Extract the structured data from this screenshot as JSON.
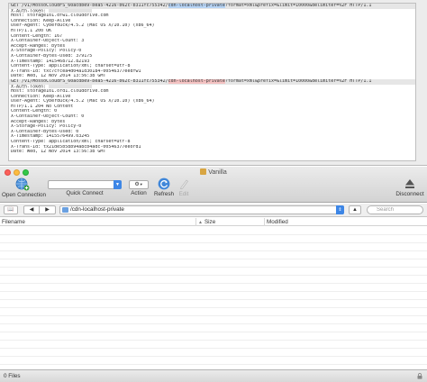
{
  "transcript": {
    "lines": [
      {
        "kind": "req",
        "parts": [
          {
            "t": "GET /v1/MossoCloudFS_60acdbe9-bea5-4216-b62c-b311fc755342/"
          },
          {
            "t": "cdn-localhost-private",
            "mark": "blue"
          },
          {
            "t": "?format=xml&prefix=&limit=10000&delimiter=%2F HTTP/1.1"
          }
        ]
      },
      {
        "kind": "hdr",
        "parts": [
          {
            "t": "X-Auth-Token: "
          },
          {
            "redact": true
          }
        ]
      },
      {
        "kind": "hdr",
        "parts": [
          {
            "t": "Host: storage101.dfw1.clouddrive.com"
          }
        ]
      },
      {
        "kind": "hdr",
        "parts": [
          {
            "t": "Connection: Keep-Alive"
          }
        ]
      },
      {
        "kind": "hdr",
        "parts": [
          {
            "t": "User-Agent: Cyberduck/4.5.2 (Mac OS X/10.10) (x86_64)"
          }
        ]
      },
      {
        "kind": "hdr",
        "parts": [
          {
            "t": "HTTP/1.1 200 OK"
          }
        ]
      },
      {
        "kind": "hdr",
        "parts": [
          {
            "t": "Content-Length: 167"
          }
        ]
      },
      {
        "kind": "hdr",
        "parts": [
          {
            "t": "X-Container-Object-Count: 3"
          }
        ]
      },
      {
        "kind": "hdr",
        "parts": [
          {
            "t": "Accept-Ranges: bytes"
          }
        ]
      },
      {
        "kind": "hdr",
        "parts": [
          {
            "t": "X-Storage-Policy: Policy-0"
          }
        ]
      },
      {
        "kind": "hdr",
        "parts": [
          {
            "t": "X-Container-Bytes-Used: 379175"
          }
        ]
      },
      {
        "kind": "hdr",
        "parts": [
          {
            "t": "X-Timestamp: 1415468712.82193"
          }
        ]
      },
      {
        "kind": "hdr",
        "parts": [
          {
            "t": "Content-Type: application/xml; charset=utf-8"
          }
        ]
      },
      {
        "kind": "hdr",
        "parts": [
          {
            "t": "X-Trans-Id: txc7cfcea4d04a1d30184-00546377eedfw1"
          }
        ]
      },
      {
        "kind": "hdr",
        "parts": [
          {
            "t": "Date: Wed, 12 Nov 2014 13:56:38 GMT"
          }
        ]
      },
      {
        "kind": "req",
        "parts": [
          {
            "t": "GET /v1/MossoCloudFS_60acdbe9-bea5-4216-b62c-b311fc755342/"
          },
          {
            "t": "cdn-localhost-private",
            "mark": "red"
          },
          {
            "t": "?format=xml&prefix=&limit=10000&delimiter=%2F HTTP/1.1"
          }
        ]
      },
      {
        "kind": "hdr",
        "parts": [
          {
            "t": "X-Auth-Token: "
          },
          {
            "redact": true
          }
        ]
      },
      {
        "kind": "hdr",
        "parts": [
          {
            "t": "Host: storage101.ord1.clouddrive.com"
          }
        ]
      },
      {
        "kind": "hdr",
        "parts": [
          {
            "t": "Connection: Keep-Alive"
          }
        ]
      },
      {
        "kind": "hdr",
        "parts": [
          {
            "t": "User-Agent: Cyberduck/4.5.2 (Mac OS X/10.10) (x86_64)"
          }
        ]
      },
      {
        "kind": "hdr",
        "parts": [
          {
            "t": "HTTP/1.1 204 No Content"
          }
        ]
      },
      {
        "kind": "hdr",
        "parts": [
          {
            "t": "Content-Length: 0"
          }
        ]
      },
      {
        "kind": "hdr",
        "parts": [
          {
            "t": "X-Container-Object-Count: 0"
          }
        ]
      },
      {
        "kind": "hdr",
        "parts": [
          {
            "t": "Accept-Ranges: bytes"
          }
        ]
      },
      {
        "kind": "hdr",
        "parts": [
          {
            "t": "X-Storage-Policy: Policy-0"
          }
        ]
      },
      {
        "kind": "hdr",
        "parts": [
          {
            "t": "X-Container-Bytes-Used: 0"
          }
        ]
      },
      {
        "kind": "hdr",
        "parts": [
          {
            "t": "X-Timestamp: 1415576499.03245"
          }
        ]
      },
      {
        "kind": "hdr",
        "parts": [
          {
            "t": "Content-Type: application/xml; charset=utf-8"
          }
        ]
      },
      {
        "kind": "hdr",
        "parts": [
          {
            "t": "X-Trans-Id: tx21de5b58b94a8cb4adc-00546377eeord1"
          }
        ]
      },
      {
        "kind": "hdr",
        "parts": [
          {
            "t": "Date: Wed, 12 Nov 2014 13:56:38 GMT"
          }
        ]
      }
    ]
  },
  "window": {
    "title": "Vanilla"
  },
  "toolbar": {
    "open_connection": "Open Connection",
    "quick_connect": "Quick Connect",
    "action": "Action",
    "refresh": "Refresh",
    "edit": "Edit",
    "disconnect": "Disconnect"
  },
  "pathbar": {
    "path": "/cdn-localhost-private",
    "search_placeholder": "Search"
  },
  "table": {
    "columns": [
      "Filename",
      "Size",
      "Modified"
    ]
  },
  "status": {
    "text": "0 Files"
  },
  "colors": {
    "accent": "#3d86e6",
    "highlight_blue": "#b7d4f5",
    "highlight_red": "#f4c2c2"
  },
  "icons": {
    "open_connection": "globe-plus-icon",
    "action": "gear-icon",
    "refresh": "refresh-icon",
    "edit": "pencil-icon",
    "disconnect": "eject-icon",
    "bookmarks": "book-icon",
    "search": "search-icon",
    "status": "lock-icon"
  }
}
